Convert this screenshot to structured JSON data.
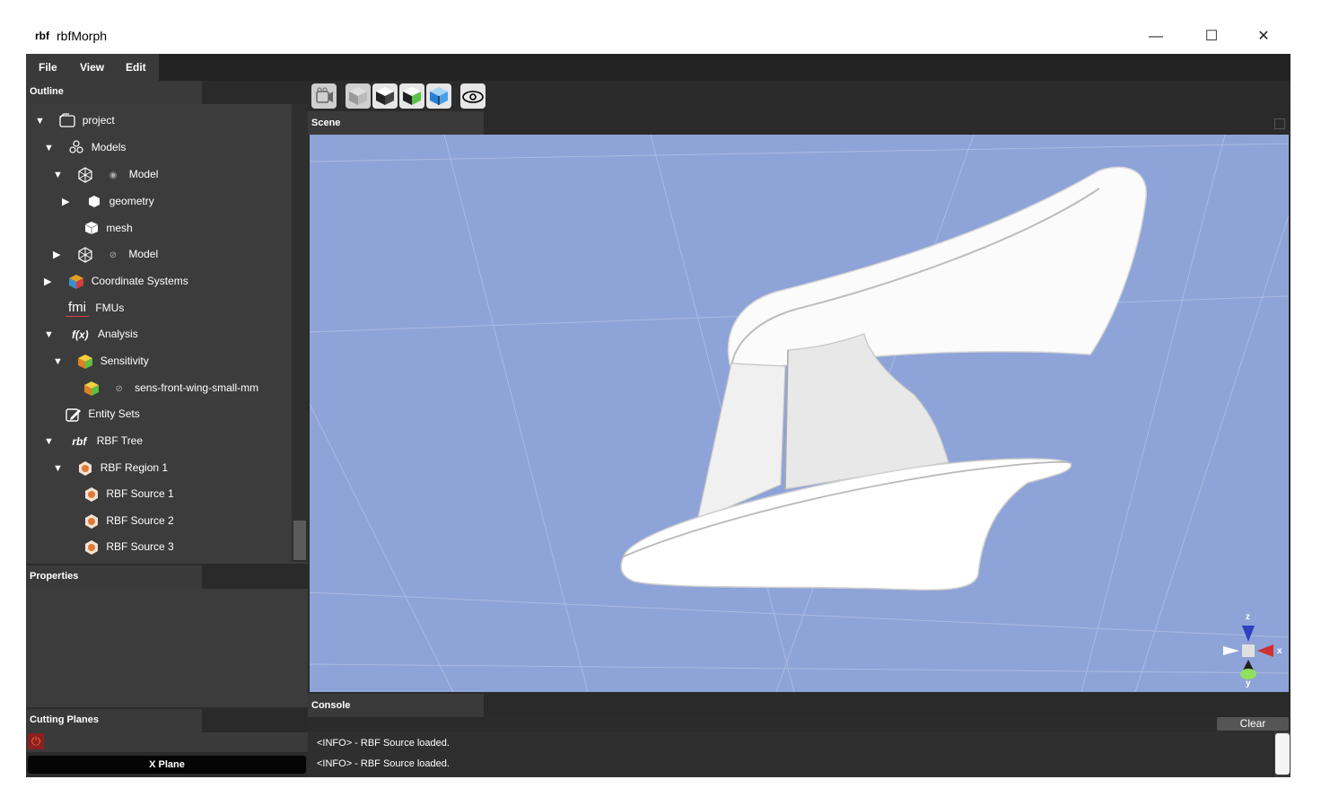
{
  "window": {
    "logo": "rbf",
    "title": "rbfMorph",
    "min": "—",
    "max": "☐",
    "close": "✕"
  },
  "menu": {
    "file": "File",
    "view": "View",
    "edit": "Edit"
  },
  "outline": {
    "title": "Outline",
    "items": [
      {
        "label": "project",
        "arrow": "▼",
        "icon": "folder-icon"
      },
      {
        "label": "Models",
        "arrow": "▼",
        "icon": "models-icon"
      },
      {
        "label": "Model",
        "arrow": "▼",
        "icon": "model-icon"
      },
      {
        "label": "geometry",
        "arrow": "▶",
        "icon": "geometry-icon"
      },
      {
        "label": "mesh",
        "arrow": "",
        "icon": "mesh-icon"
      },
      {
        "label": "Model",
        "arrow": "▶",
        "icon": "model-icon"
      },
      {
        "label": "Coordinate Systems",
        "arrow": "▶",
        "icon": "coordinate-systems-icon"
      },
      {
        "label": "FMUs",
        "arrow": "",
        "icon": "fmi-icon"
      },
      {
        "label": "Analysis",
        "arrow": "▼",
        "icon": "function-icon"
      },
      {
        "label": "Sensitivity",
        "arrow": "▼",
        "icon": "sensitivity-icon"
      },
      {
        "label": "sens-front-wing-small-mm",
        "arrow": "",
        "icon": "sensitivity-item-icon"
      },
      {
        "label": "Entity Sets",
        "arrow": "",
        "icon": "edit-icon"
      },
      {
        "label": "RBF Tree",
        "arrow": "▼",
        "icon": "rbf-icon"
      },
      {
        "label": "RBF Region 1",
        "arrow": "▼",
        "icon": "region-icon"
      },
      {
        "label": "RBF Source 1",
        "arrow": "",
        "icon": "source-icon"
      },
      {
        "label": "RBF Source 2",
        "arrow": "",
        "icon": "source-icon"
      },
      {
        "label": "RBF Source 3",
        "arrow": "",
        "icon": "source-icon"
      }
    ],
    "fmi_text": "fmi",
    "fx_text": "f(x)",
    "rbf_text": "rbf"
  },
  "properties": {
    "title": "Properties"
  },
  "cutting_planes": {
    "title": "Cutting Planes",
    "x_plane": "X Plane"
  },
  "scene": {
    "title": "Scene",
    "axis_x": "x",
    "axis_y": "y",
    "axis_z": "z"
  },
  "console": {
    "title": "Console",
    "clear": "Clear",
    "lines": [
      "<INFO> - RBF Source loaded.",
      "<INFO> - RBF Source loaded."
    ]
  },
  "colors": {
    "viewport": "#8ea3d8",
    "panel": "#3c3c3c",
    "accent_orange": "#e07a3a"
  }
}
